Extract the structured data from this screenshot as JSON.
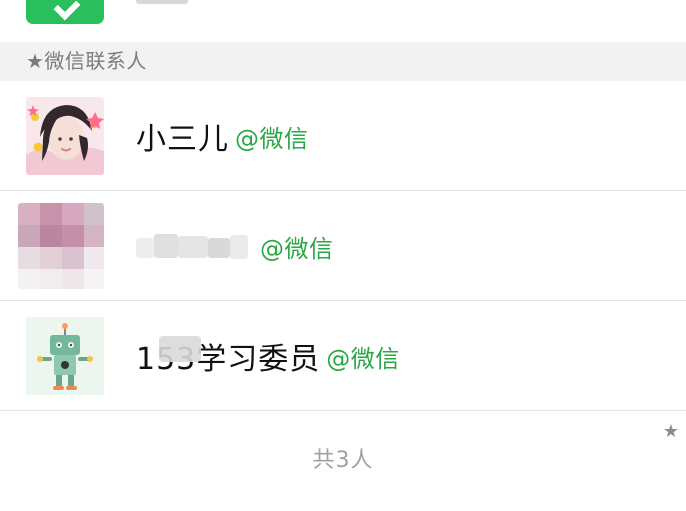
{
  "section": {
    "title": "★微信联系人"
  },
  "contacts": [
    {
      "name": "小三儿",
      "tag": "@微信",
      "avatar_icon": "girl-avatar-icon"
    },
    {
      "name": "",
      "tag": "@微信",
      "avatar_icon": "blurred-avatar-icon"
    },
    {
      "name": "153学习委员",
      "tag": "@微信",
      "avatar_icon": "robot-avatar-icon"
    }
  ],
  "footer": {
    "count_text": "共3人",
    "corner_icon": "★"
  },
  "colors": {
    "accent_green": "#28a745",
    "brand_green": "#29bf5d",
    "section_bg": "#f2f2f2",
    "divider": "#e5e5e5"
  },
  "icons": {
    "top_icon": "check-icon"
  }
}
